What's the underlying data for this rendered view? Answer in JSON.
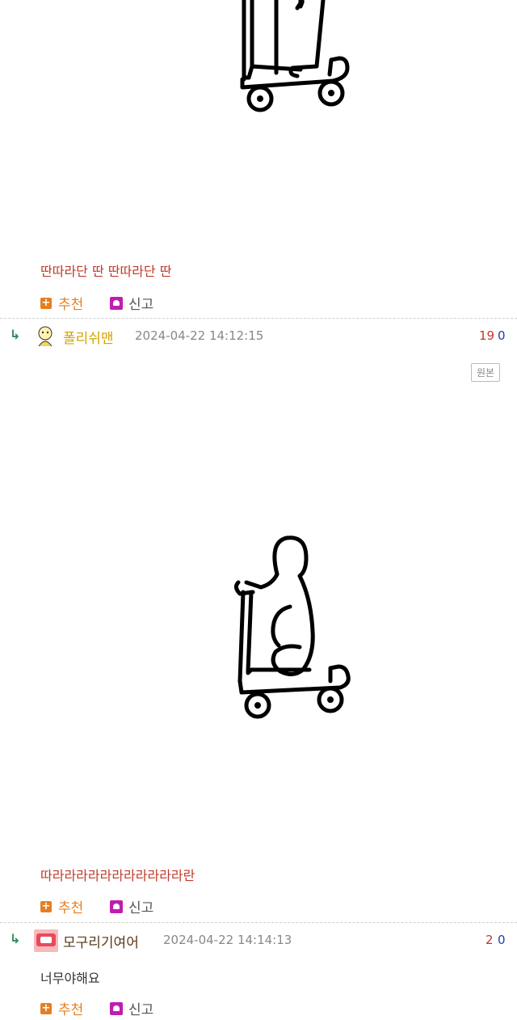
{
  "comments": [
    {
      "text": "딴따라단 딴 딴따라단 딴",
      "recommend_label": "추천",
      "report_label": "신고"
    },
    {
      "author": "폴리쉬맨",
      "timestamp": "2024-04-22 14:12:15",
      "votes_up": "19",
      "votes_down": "0",
      "original_button": "원본",
      "text": "따라라라라라라라라라라라란",
      "recommend_label": "추천",
      "report_label": "신고"
    },
    {
      "author": "모구리기여어",
      "timestamp": "2024-04-22 14:14:13",
      "votes_up": "2",
      "votes_down": "0",
      "text": "너무야해요",
      "recommend_label": "추천",
      "report_label": "신고"
    }
  ],
  "colors": {
    "accent_orange": "#e67e22",
    "report_magenta": "#c01db0",
    "text_red": "#c0392b",
    "vote_down_blue": "#1f3fa8"
  }
}
